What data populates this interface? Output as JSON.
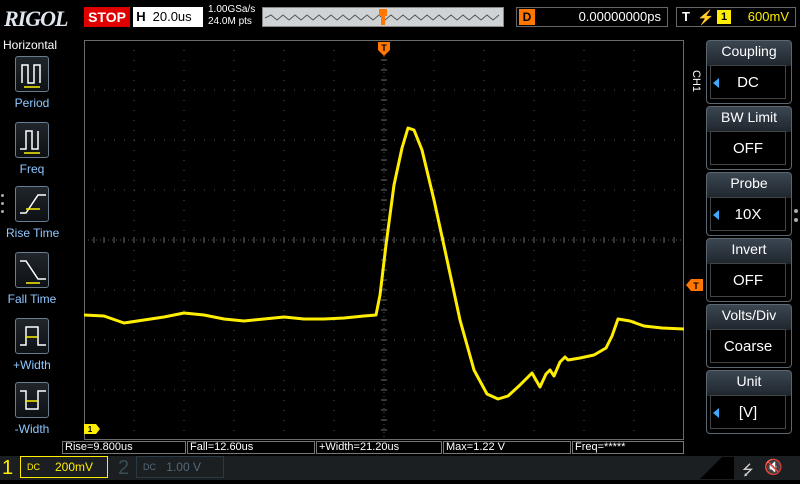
{
  "header": {
    "brand": "RIGOL",
    "run_state": "STOP",
    "horizontal_label": "H",
    "timebase": "20.0us",
    "sample_rate": "1.00GSa/s",
    "memory_depth": "24.0M pts",
    "delay_label": "D",
    "delay_value": "0.00000000ps",
    "trigger_label": "T",
    "trigger_source": "1",
    "trigger_level": "600mV"
  },
  "left_panel": {
    "title": "Horizontal",
    "items": [
      {
        "label": "Period",
        "icon": "period-icon"
      },
      {
        "label": "Freq",
        "icon": "freq-icon"
      },
      {
        "label": "Rise Time",
        "icon": "rise-time-icon"
      },
      {
        "label": "Fall Time",
        "icon": "fall-time-icon"
      },
      {
        "label": "+Width",
        "icon": "positive-width-icon"
      },
      {
        "label": "-Width",
        "icon": "negative-width-icon"
      }
    ]
  },
  "right_panel": {
    "channel_tab": "CH1",
    "items": [
      {
        "title": "Coupling",
        "value": "DC",
        "arrow": true
      },
      {
        "title": "BW Limit",
        "value": "OFF",
        "arrow": false
      },
      {
        "title": "Probe",
        "value": "10X",
        "arrow": true
      },
      {
        "title": "Invert",
        "value": "OFF",
        "arrow": false
      },
      {
        "title": "Volts/Div",
        "value": "Coarse",
        "arrow": false
      },
      {
        "title": "Unit",
        "value": "[V]",
        "arrow": true
      }
    ]
  },
  "markers": {
    "trigger_top": "T",
    "trigger_level_marker": "T",
    "channel_ground_marker": "1"
  },
  "measurements": [
    {
      "label": "Rise=9.800us"
    },
    {
      "label": "Fall=12.60us"
    },
    {
      "label": "+Width=21.20us"
    },
    {
      "label": "Max=1.22 V"
    },
    {
      "label": "Freq=*****"
    }
  ],
  "footer": {
    "ch1_number": "1",
    "ch1_scale": "200mV",
    "ch2_number": "2",
    "ch2_scale": "1.00 V",
    "coupling_symbol": "DC"
  },
  "colors": {
    "ch1": "#ffee00",
    "trigger": "#ff7700",
    "stop": "#e00000",
    "menu_accent": "#3fa8ff"
  }
}
